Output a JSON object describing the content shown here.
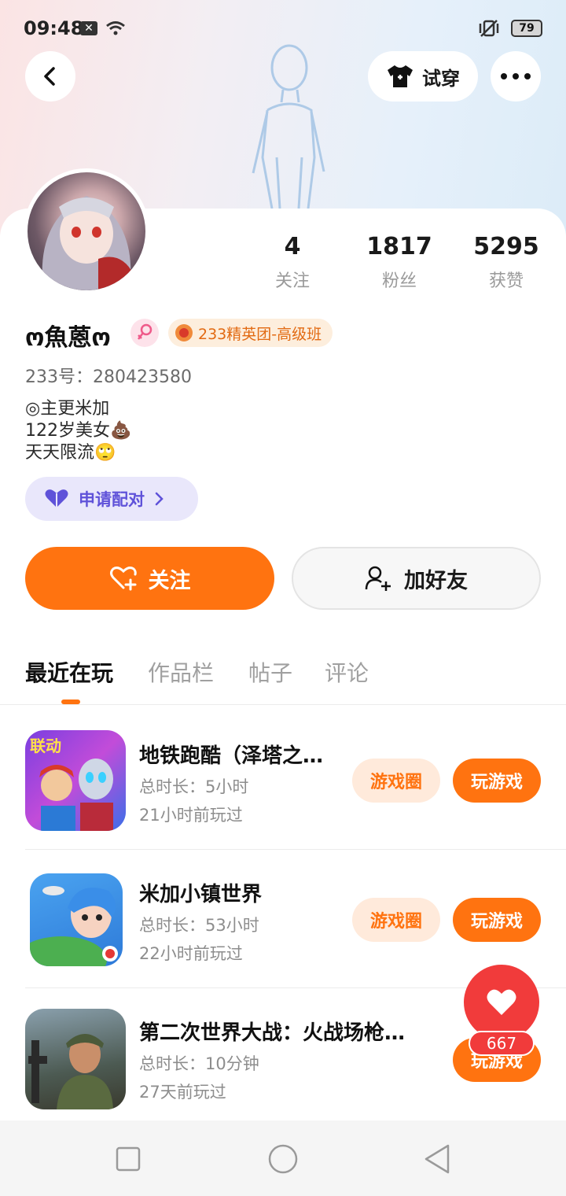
{
  "status_bar": {
    "time": "09:48",
    "battery": "79"
  },
  "header": {
    "try_on_label": "试穿"
  },
  "profile": {
    "stats": [
      {
        "value": "4",
        "label": "关注"
      },
      {
        "value": "1817",
        "label": "粉丝"
      },
      {
        "value": "5295",
        "label": "获赞"
      }
    ],
    "nickname": "ო魚蒽ო",
    "badge": "233精英团-高级班",
    "uid": "233号：280423580",
    "bio": [
      "◎主更米加",
      "122岁美女💩",
      "天天限流🙄"
    ],
    "pair_label": "申请配对"
  },
  "actions": {
    "follow_label": "关注",
    "add_friend_label": "加好友"
  },
  "tabs": [
    {
      "label": "最近在玩",
      "active": true
    },
    {
      "label": "作品栏",
      "active": false
    },
    {
      "label": "帖子",
      "active": false
    },
    {
      "label": "评论",
      "active": false
    }
  ],
  "games": [
    {
      "title": "地铁跑酷（泽塔之…",
      "duration": "总时长：5小时",
      "last_played": "21小时前玩过",
      "circle_label": "游戏圈",
      "play_label": "玩游戏",
      "icon_text": "联动"
    },
    {
      "title": "米加小镇世界",
      "duration": "总时长：53小时",
      "last_played": "22小时前玩过",
      "circle_label": "游戏圈",
      "play_label": "玩游戏"
    },
    {
      "title": "第二次世界大战：火战场枪…",
      "duration": "总时长：10分钟",
      "last_played": "27天前玩过",
      "play_label": "玩游戏"
    }
  ],
  "fab": {
    "count": "667"
  },
  "colors": {
    "accent": "#ff7310",
    "fab": "#f13b3b",
    "pair": "#5f52d9"
  }
}
